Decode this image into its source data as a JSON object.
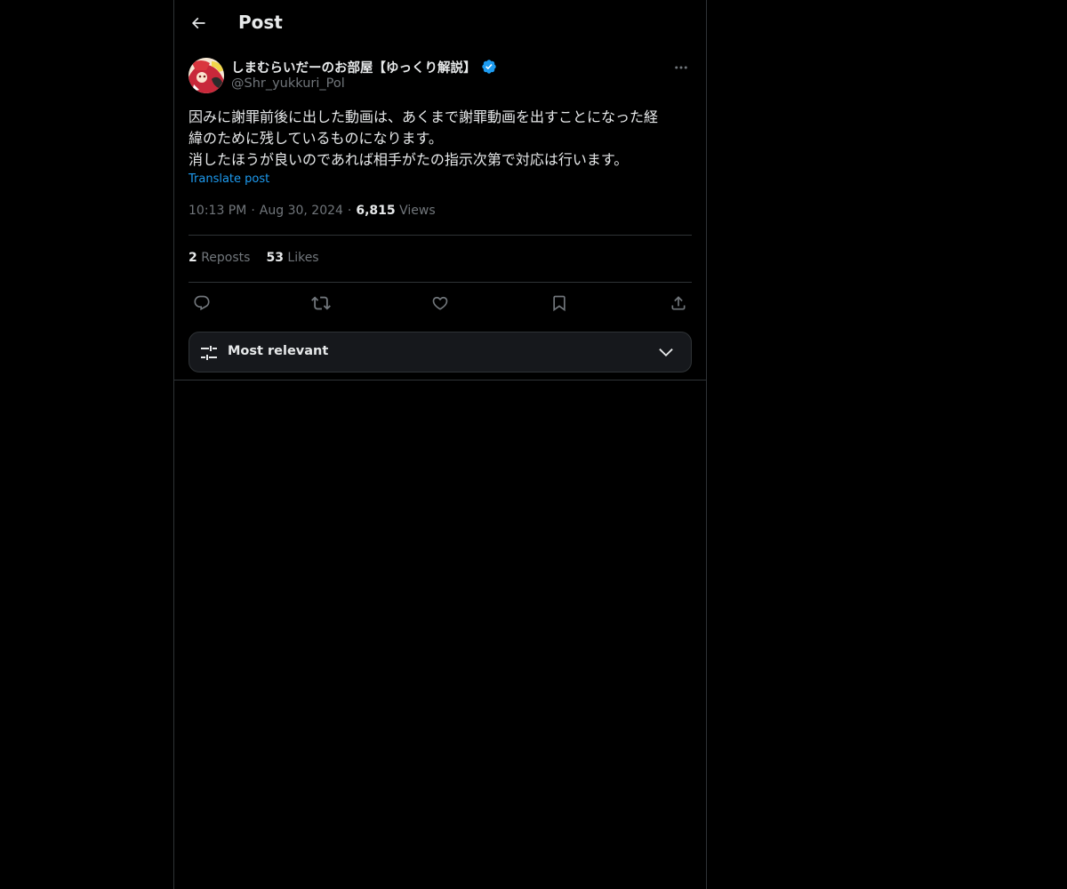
{
  "header": {
    "title": "Post"
  },
  "post": {
    "author": {
      "display_name": "しまむらいだーのお部屋【ゆっくり解説】",
      "handle": "@Shr_yukkuri_Pol",
      "verified": true
    },
    "text_lines": [
      "因みに謝罪前後に出した動画は、あくまで謝罪動画を出すことになった経",
      "緯のために残しているものになります。",
      "消したほうが良いのであれば相手がたの指示次第で対応は行います。"
    ],
    "translate_label": "Translate post",
    "time": "10:13 PM",
    "date": "Aug 30, 2024",
    "separator": "·",
    "views_count": "6,815",
    "views_label": "Views",
    "reposts_count": "2",
    "reposts_label": "Reposts",
    "likes_count": "53",
    "likes_label": "Likes"
  },
  "actions": {
    "icons": [
      "reply-icon",
      "repost-icon",
      "like-icon",
      "bookmark-icon",
      "share-icon"
    ]
  },
  "replies_sort": {
    "label": "Most relevant"
  },
  "colors": {
    "background": "#000000",
    "text": "#e7e9ea",
    "secondary_text": "#71767b",
    "accent": "#1d9bf0",
    "border": "#2f3336"
  }
}
